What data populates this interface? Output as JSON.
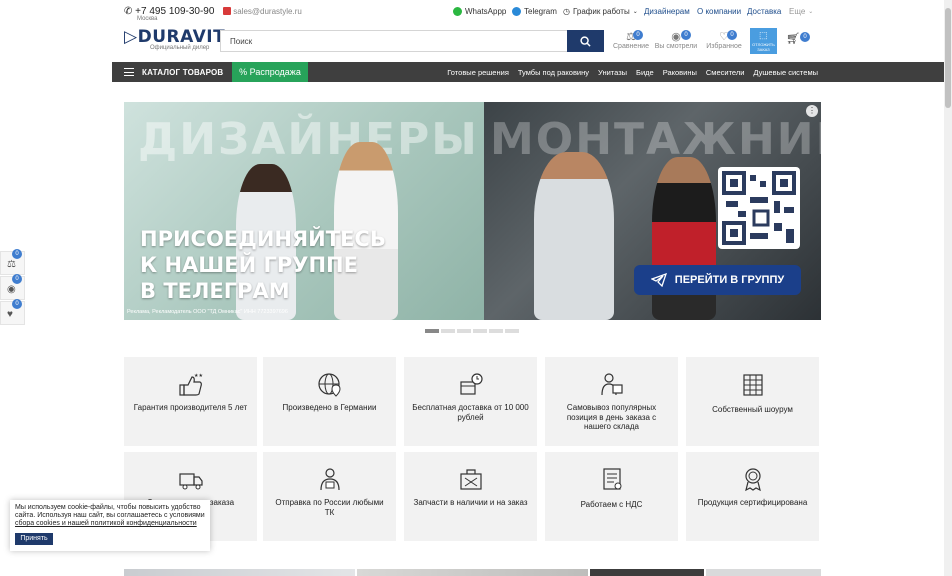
{
  "topbar": {
    "phone": "+7 495 109-30-90",
    "phone_city": "Москва",
    "email": "sales@durastyle.ru",
    "whatsapp": "WhatsAppp",
    "telegram": "Telegram",
    "schedule": "График работы",
    "designers": "Дизайнерам",
    "about": "О компании",
    "delivery": "Доставка",
    "more": "Еще"
  },
  "header": {
    "logo": "DURAVIT",
    "logo_sub": "Официальный дилер",
    "search_placeholder": "Поиск",
    "compare_label": "Сравнение",
    "compare_count": "0",
    "viewed_label": "Вы смотрели",
    "viewed_count": "0",
    "favorites_label": "Избранное",
    "favorites_count": "0",
    "order_label": "ОТЛОЖИТЬ ЗАКАЗ",
    "cart_count": "0"
  },
  "nav": {
    "catalog": "КАТАЛОГ ТОВАРОВ",
    "sale": "% Распродажа",
    "links": [
      "Готовые решения",
      "Тумбы под раковину",
      "Унитазы",
      "Биде",
      "Раковины",
      "Смесители",
      "Душевые системы"
    ]
  },
  "banner": {
    "word_left": "ДИЗАЙНЕРЫ",
    "word_right": "МОНТАЖНИКИ",
    "headline_1": "ПРИСОЕДИНЯЙТЕСЬ",
    "headline_2": "К НАШЕЙ ГРУППЕ",
    "headline_3": "В ТЕЛЕГРАМ",
    "cta": "ПЕРЕЙТИ В ГРУППУ",
    "legal": "Реклама, Рекламодатель ООО \"ТД Омникас\" ИНН 7723397696"
  },
  "slider": {
    "count": 6,
    "active": 0
  },
  "features": [
    {
      "text": "Гарантия производителя 5 лет",
      "icon": "thumbs-up-stars-icon"
    },
    {
      "text": "Произведено в Германии",
      "icon": "globe-pin-icon"
    },
    {
      "text": "Бесплатная доставка от 10 000 рублей",
      "icon": "box-clock-icon"
    },
    {
      "text": "Самовывоз популярных позиция в день заказа с нашего склада",
      "icon": "worker-box-icon"
    },
    {
      "text": "Собственный шоурум",
      "icon": "building-icon"
    },
    {
      "text": "Доставка в день заказа",
      "icon": "truck-icon"
    },
    {
      "text": "Отправка по России любыми ТК",
      "icon": "courier-icon"
    },
    {
      "text": "Запчасти в наличии и на заказ",
      "icon": "toolbox-icon"
    },
    {
      "text": "Работаем с НДС",
      "icon": "document-icon"
    },
    {
      "text": "Продукция сертифицирована",
      "icon": "award-icon"
    }
  ],
  "side": {
    "compare_count": "0",
    "viewed_count": "0",
    "favorites_count": "0"
  },
  "cookie": {
    "text": "Мы используем cookie-файлы, чтобы повысить удобство сайта. Используя наш сайт, вы соглашаетесь с условиями",
    "link": "сбора cookies и нашей политикой конфиденциальности",
    "accept": "Принять"
  },
  "colors": {
    "brand": "#1f3a6b",
    "sale": "#27a35a",
    "badge": "#3f7dcf",
    "navbar": "#3f3f3f"
  }
}
